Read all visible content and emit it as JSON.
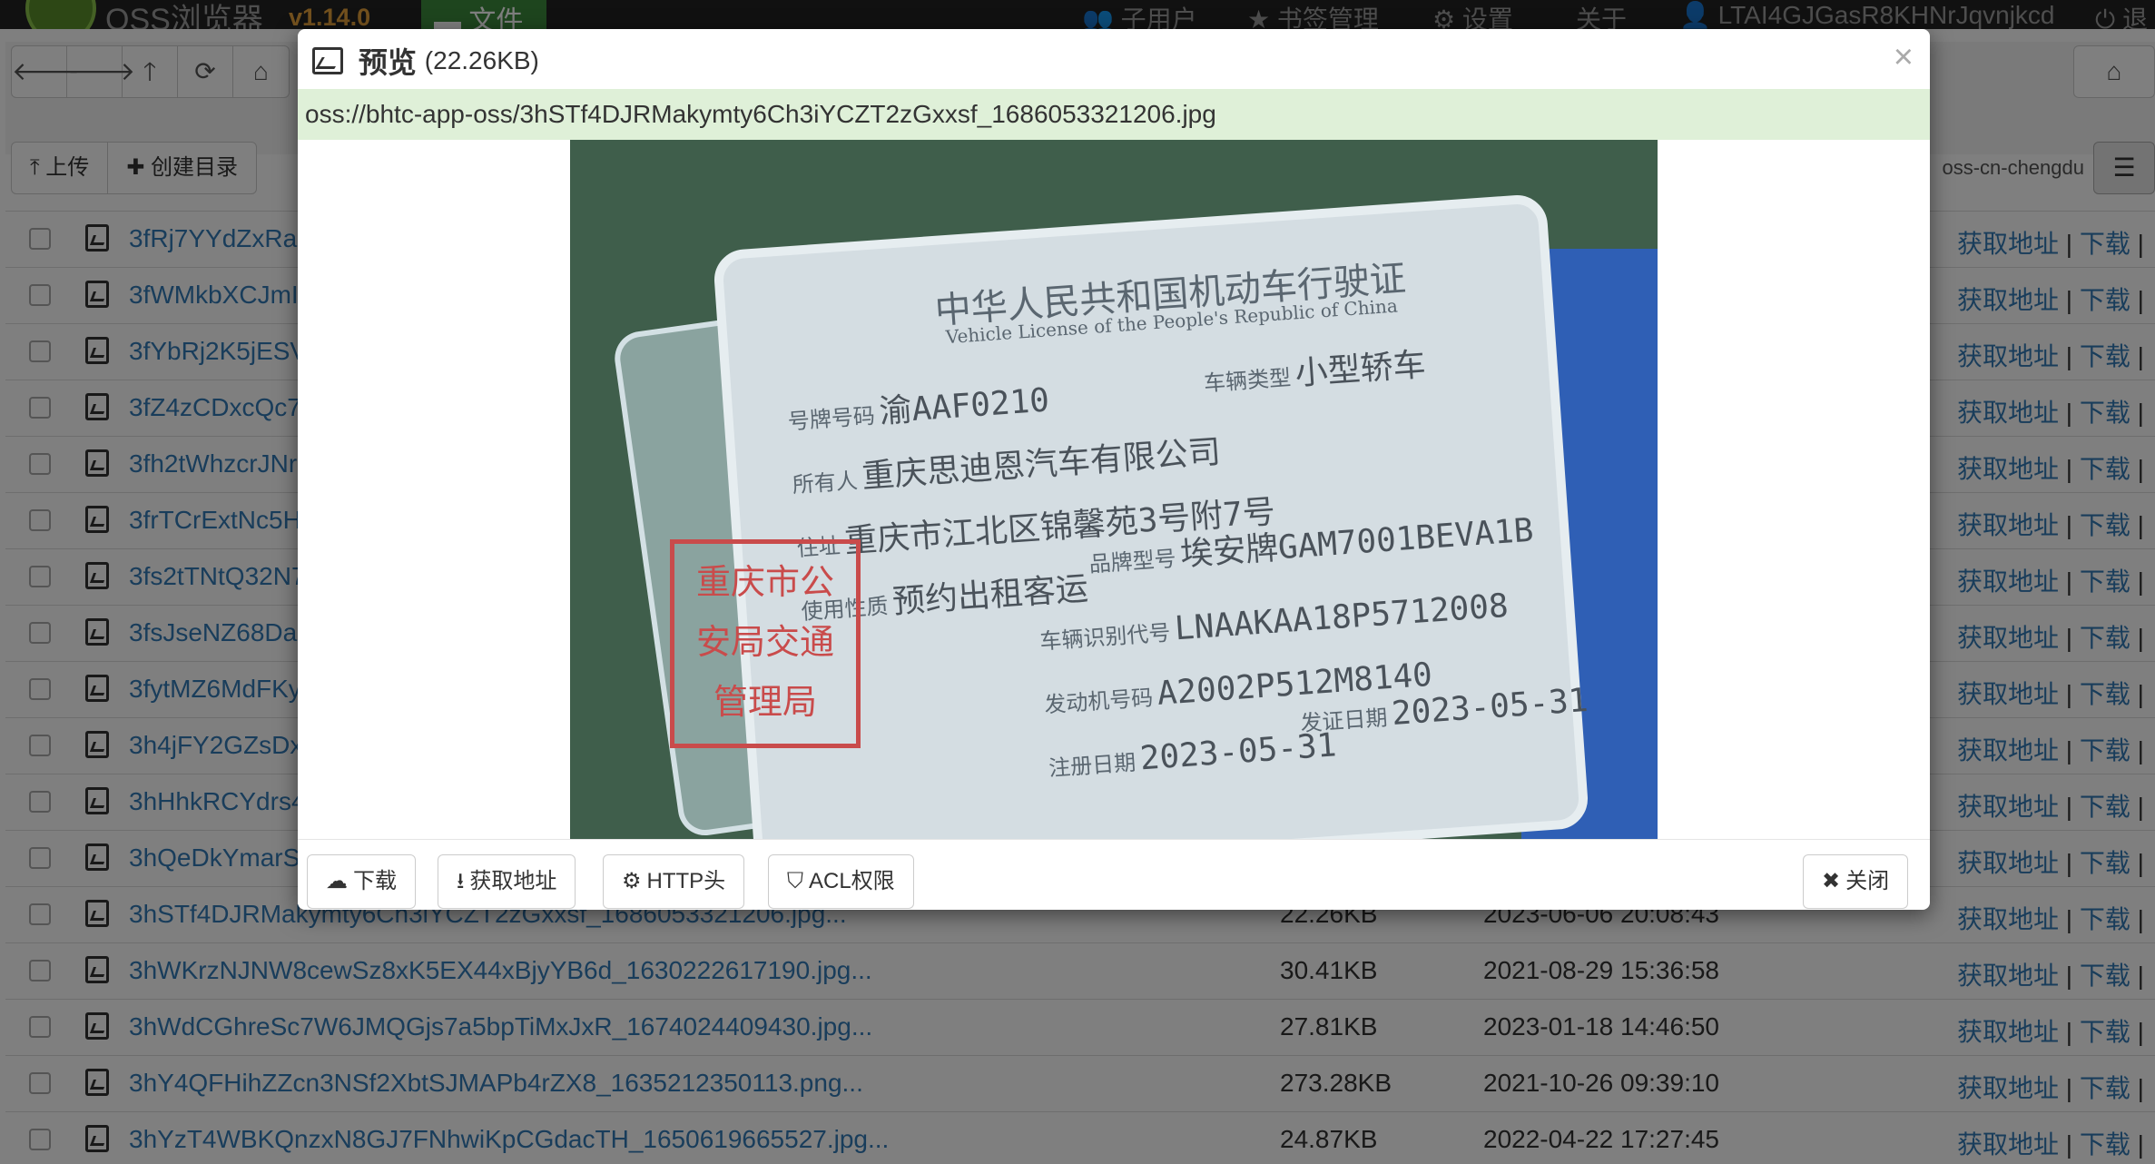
{
  "navbar": {
    "brand": "OSS浏览器",
    "version": "v1.14.0",
    "files_tab": "文件",
    "items": [
      {
        "label": "子用户",
        "icon": "users-icon"
      },
      {
        "label": "书签管理",
        "icon": "star-icon"
      },
      {
        "label": "设置",
        "icon": "gear-icon"
      },
      {
        "label": "关于",
        "icon": ""
      },
      {
        "label": "LTAI4GJGasR8KHNrJqvnjkcd",
        "icon": "user-icon"
      },
      {
        "label": "退",
        "icon": "power-icon"
      }
    ]
  },
  "toolbar": {
    "upload_label": "上传",
    "mkdir_label": "创建目录",
    "region": "oss-cn-chengdu"
  },
  "files": [
    {
      "name": "3fRj7YYdZxRa",
      "size": "",
      "date": ""
    },
    {
      "name": "3fWMkbXCJmI",
      "size": "",
      "date": ""
    },
    {
      "name": "3fYbRj2K5jESV",
      "size": "",
      "date": ""
    },
    {
      "name": "3fZ4zCDxcQc7",
      "size": "",
      "date": ""
    },
    {
      "name": "3fh2tWhzcrJNr",
      "size": "",
      "date": ""
    },
    {
      "name": "3frTCrExtNc5H",
      "size": "",
      "date": ""
    },
    {
      "name": "3fs2tTNtQ32N7",
      "size": "",
      "date": ""
    },
    {
      "name": "3fsJseNZ68Da",
      "size": "",
      "date": ""
    },
    {
      "name": "3fytMZ6MdFKy",
      "size": "",
      "date": ""
    },
    {
      "name": "3h4jFY2GZsDx",
      "size": "",
      "date": ""
    },
    {
      "name": "3hHhkRCYdrs4",
      "size": "",
      "date": ""
    },
    {
      "name": "3hQeDkYmarS",
      "size": "",
      "date": ""
    },
    {
      "name": "3hSTf4DJRMakymty6Ch3iYCZT2zGxxsf_1686053321206.jpg...",
      "size": "22.26KB",
      "date": "2023-06-06 20:08:43"
    },
    {
      "name": "3hWKrzNJNW8cewSz8xK5EX44xBjyYB6d_1630222617190.jpg...",
      "size": "30.41KB",
      "date": "2021-08-29 15:36:58"
    },
    {
      "name": "3hWdCGhreSc7W6JMQGjs7a5bpTiMxJxR_1674024409430.jpg...",
      "size": "27.81KB",
      "date": "2023-01-18 14:46:50"
    },
    {
      "name": "3hY4QFHihZZcn3NSf2XbtSJMAPb4rZX8_1635212350113.png...",
      "size": "273.28KB",
      "date": "2021-10-26 09:39:10"
    },
    {
      "name": "3hYzT4WBKQnzxN8GJ7FNhwiKpCGdacTH_1650619665527.jpg...",
      "size": "24.87KB",
      "date": "2022-04-22 17:27:45"
    }
  ],
  "row_actions": {
    "get_url": "获取地址",
    "download": "下载",
    "sep": "|"
  },
  "modal": {
    "title": "预览",
    "size": "(22.26KB)",
    "path": "oss://bhtc-app-oss/3hSTf4DJRMakymty6Ch3iYCZT2zGxxsf_1686053321206.jpg",
    "buttons": {
      "download": "下载",
      "get_url": "获取地址",
      "http_headers": "HTTP头",
      "acl": "ACL权限",
      "close": "关闭"
    },
    "photo": {
      "title": "中华人民共和国机动车行驶证",
      "subtitle": "Vehicle License of the People's Republic of China",
      "fields": [
        {
          "label": "号牌号码",
          "value": "渝AAF0210"
        },
        {
          "label": "车辆类型",
          "value": "小型轿车"
        },
        {
          "label": "所有人",
          "value": "重庆思迪恩汽车有限公司"
        },
        {
          "label": "住址",
          "value": "重庆市江北区锦馨苑3号附7号"
        },
        {
          "label": "使用性质",
          "value": "预约出租客运"
        },
        {
          "label": "品牌型号",
          "value": "埃安牌GAM7001BEVA1B"
        },
        {
          "label": "车辆识别代号",
          "value": "LNAAKAA18P5712008"
        },
        {
          "label": "发动机号码",
          "value": "A2002P512M8140"
        },
        {
          "label": "注册日期",
          "value": "2023-05-31"
        },
        {
          "label": "发证日期",
          "value": "2023-05-31"
        }
      ],
      "stamp": [
        "重庆市公",
        "安局交通",
        "管理局"
      ]
    }
  }
}
